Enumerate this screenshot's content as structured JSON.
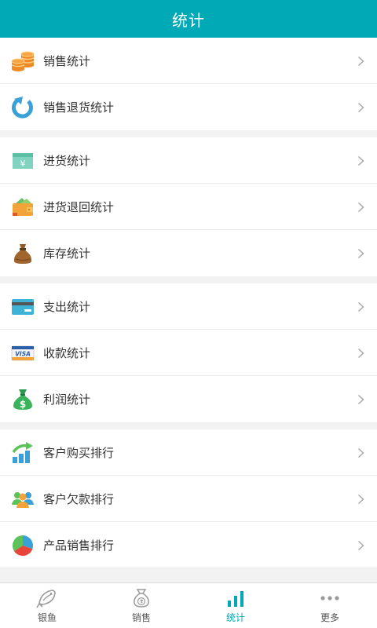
{
  "header": {
    "title": "统计"
  },
  "colors": {
    "accent": "#00a9b6",
    "background": "#f2f2f2",
    "text": "#333333"
  },
  "groups": [
    {
      "items": [
        {
          "label": "销售统计",
          "icon": "coins-icon"
        },
        {
          "label": "销售退货统计",
          "icon": "return-arrow-icon"
        }
      ]
    },
    {
      "items": [
        {
          "label": "进货统计",
          "icon": "cash-yen-icon"
        },
        {
          "label": "进货退回统计",
          "icon": "wallet-icon"
        },
        {
          "label": "库存统计",
          "icon": "sack-icon"
        }
      ]
    },
    {
      "items": [
        {
          "label": "支出统计",
          "icon": "card-icon"
        },
        {
          "label": "收款统计",
          "icon": "visa-card-icon"
        },
        {
          "label": "利润统计",
          "icon": "money-bag-icon"
        }
      ]
    },
    {
      "items": [
        {
          "label": "客户购买排行",
          "icon": "growth-chart-icon"
        },
        {
          "label": "客户欠款排行",
          "icon": "users-icon"
        },
        {
          "label": "产品销售排行",
          "icon": "pie-chart-icon"
        }
      ]
    }
  ],
  "visa_text": "VISA",
  "yen_text": "¥",
  "dollar_text": "$",
  "tabbar": {
    "tabs": [
      {
        "label": "银鱼",
        "icon": "fish-icon",
        "active": false
      },
      {
        "label": "销售",
        "icon": "money-bag-outline-icon",
        "active": false
      },
      {
        "label": "统计",
        "icon": "bar-chart-icon",
        "active": true
      },
      {
        "label": "更多",
        "icon": "more-dots-icon",
        "active": false
      }
    ]
  }
}
